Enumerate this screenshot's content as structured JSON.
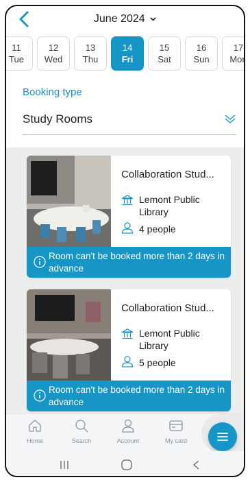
{
  "header": {
    "month_title": "June 2024"
  },
  "dates": [
    {
      "day": "11",
      "dow": "Tue",
      "selected": false
    },
    {
      "day": "12",
      "dow": "Wed",
      "selected": false
    },
    {
      "day": "13",
      "dow": "Thu",
      "selected": false
    },
    {
      "day": "14",
      "dow": "Fri",
      "selected": true
    },
    {
      "day": "15",
      "dow": "Sat",
      "selected": false
    },
    {
      "day": "16",
      "dow": "Sun",
      "selected": false
    },
    {
      "day": "17",
      "dow": "Mon",
      "selected": false
    }
  ],
  "booking": {
    "label": "Booking type",
    "value": "Study Rooms"
  },
  "rooms": [
    {
      "title": "Collaboration Stud...",
      "library": "Lemont Public Library",
      "capacity": "4 people",
      "notice": "Room can't be booked more than 2 days in advance"
    },
    {
      "title": "Collaboration Stud...",
      "library": "Lemont Public Library",
      "capacity": "5 people",
      "notice": "Room can't be booked more than 2 days in advance"
    }
  ],
  "nav": {
    "home": "Home",
    "search": "Search",
    "account": "Account",
    "my_card": "My card"
  },
  "colors": {
    "accent": "#1596c6",
    "label": "#1f8fbd",
    "list_bg": "#eceded"
  }
}
